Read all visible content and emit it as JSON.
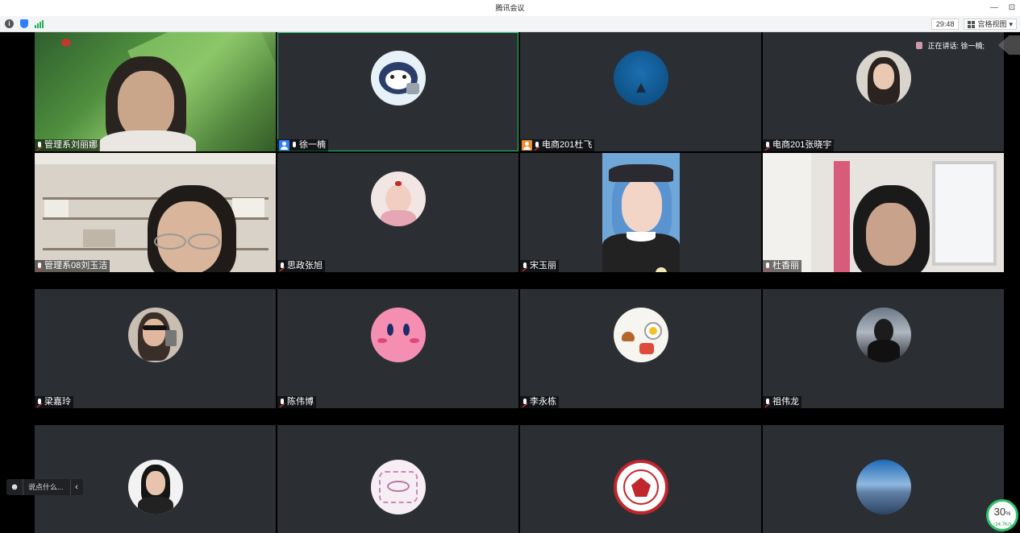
{
  "window": {
    "title": "腾讯会议",
    "minimize": "—",
    "restore": "⊡"
  },
  "toolbar": {
    "timer": "29:48",
    "view_label": "宫格视图",
    "view_caret": "▾"
  },
  "speaking": {
    "label": "正在讲话: 徐一楠;"
  },
  "chat": {
    "emoji": "☻",
    "placeholder": "说点什么...",
    "collapse": "‹"
  },
  "network": {
    "percent": "30",
    "percent_unit": "%",
    "speed": "↑24.7K/s"
  },
  "participants": [
    {
      "name": "管理系刘丽娜",
      "mic": "muted",
      "type": "video"
    },
    {
      "name": "徐一楠",
      "mic": "on",
      "badge": "host",
      "type": "avatar",
      "active": true
    },
    {
      "name": "电商201杜飞",
      "mic": "muted",
      "badge": "cohost",
      "type": "avatar"
    },
    {
      "name": "电商201张晓宇",
      "mic": "muted",
      "type": "avatar"
    },
    {
      "name": "管理系08刘玉洁",
      "mic": "muted",
      "type": "video"
    },
    {
      "name": "思政张旭",
      "mic": "muted",
      "type": "avatar"
    },
    {
      "name": "宋玉丽",
      "mic": "muted",
      "type": "video"
    },
    {
      "name": "杜香丽",
      "mic": "muted",
      "type": "video"
    },
    {
      "name": "梁嘉玲",
      "mic": "muted",
      "type": "avatar"
    },
    {
      "name": "陈伟博",
      "mic": "muted",
      "type": "avatar"
    },
    {
      "name": "李永栋",
      "mic": "muted",
      "type": "avatar"
    },
    {
      "name": "祖伟龙",
      "mic": "muted",
      "type": "avatar"
    },
    {
      "name": "",
      "type": "avatar"
    },
    {
      "name": "",
      "type": "avatar"
    },
    {
      "name": "",
      "type": "avatar"
    },
    {
      "name": "",
      "type": "avatar"
    }
  ]
}
